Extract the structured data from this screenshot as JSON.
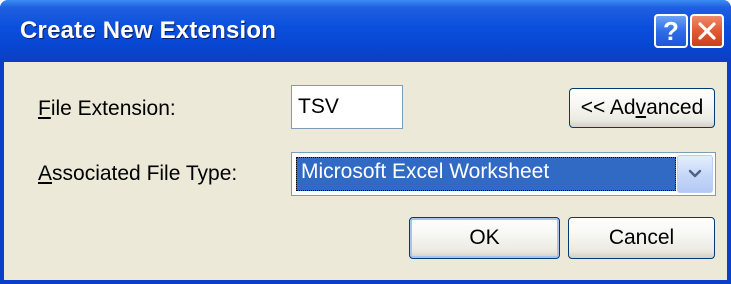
{
  "window": {
    "title": "Create New Extension",
    "help_label": "?"
  },
  "form": {
    "file_extension": {
      "label_accel": "F",
      "label_rest": "ile Extension:",
      "value": "TSV"
    },
    "file_type": {
      "label_accel": "A",
      "label_rest": "ssociated File Type:",
      "selected": "Microsoft Excel Worksheet"
    }
  },
  "buttons": {
    "advanced_pre": "<< Ad",
    "advanced_accel": "v",
    "advanced_post": "anced",
    "ok": "OK",
    "cancel": "Cancel"
  },
  "colors": {
    "titlebar": "#0a4fdc",
    "selection": "#316ac5",
    "dialog_bg": "#ece9d8",
    "close_button": "#e05a32"
  }
}
